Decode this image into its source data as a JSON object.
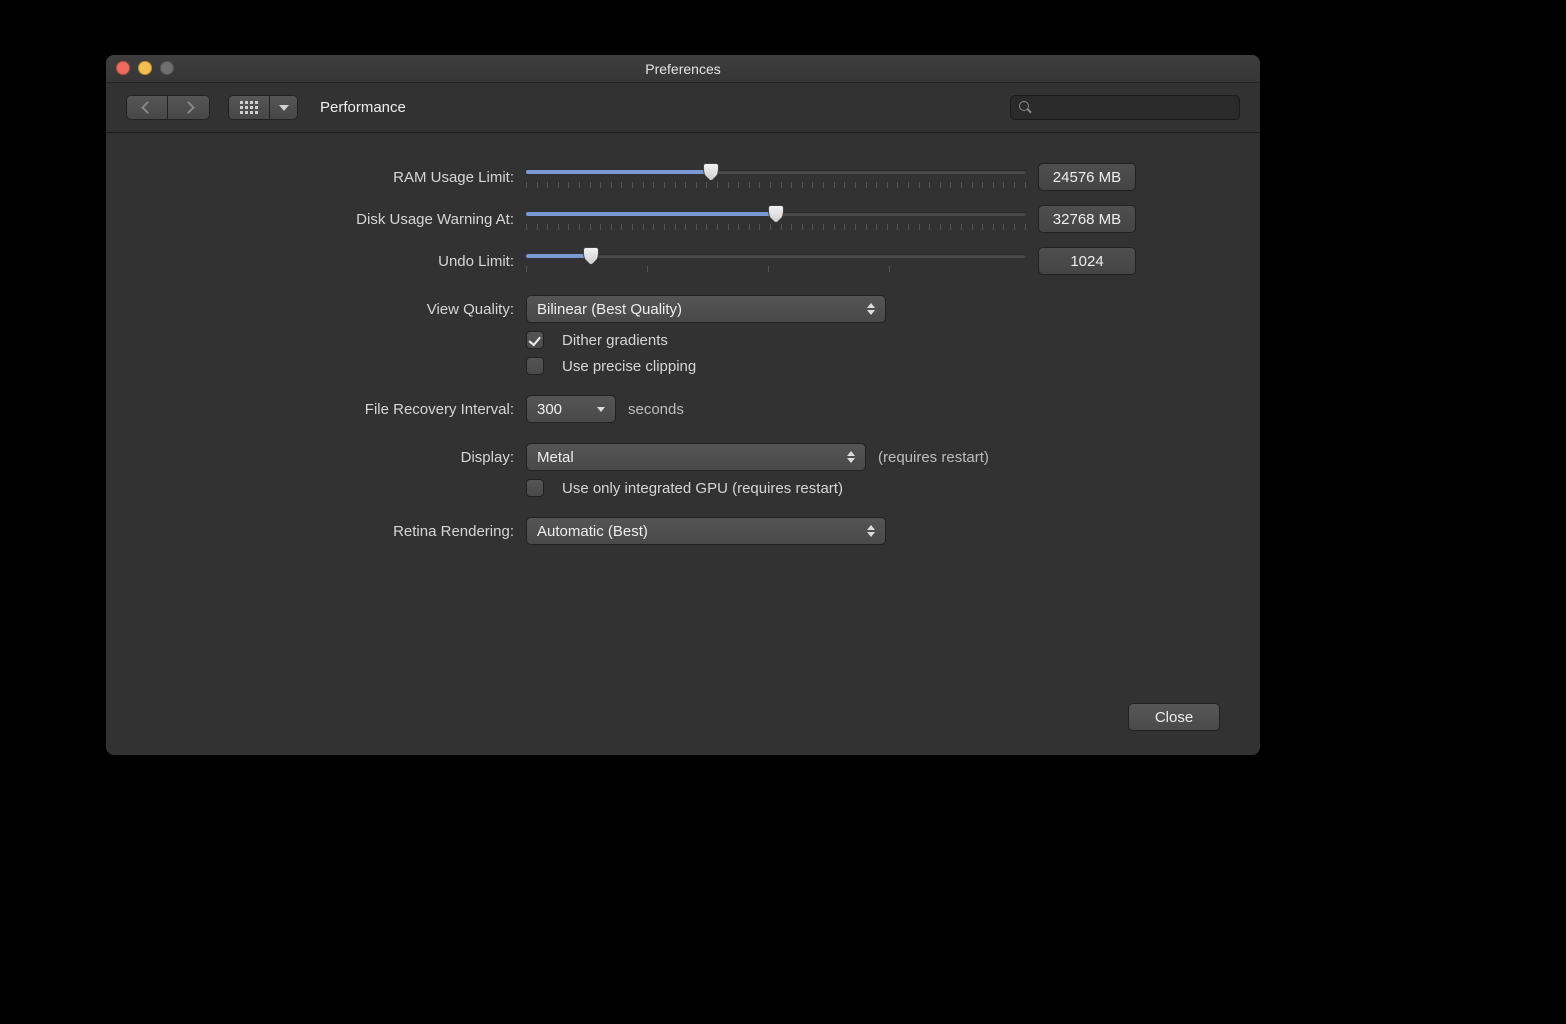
{
  "window": {
    "title": "Preferences"
  },
  "toolbar": {
    "section": "Performance",
    "search_placeholder": ""
  },
  "form": {
    "ram": {
      "label": "RAM Usage Limit:",
      "value": "24576 MB",
      "fill_pct": 37
    },
    "disk": {
      "label": "Disk Usage Warning At:",
      "value": "32768 MB",
      "fill_pct": 50
    },
    "undo": {
      "label": "Undo Limit:",
      "value": "1024",
      "fill_pct": 13
    },
    "view_quality": {
      "label": "View Quality:",
      "selected": "Bilinear (Best Quality)"
    },
    "dither": {
      "label": "Dither gradients",
      "checked": true
    },
    "precise": {
      "label": "Use precise clipping",
      "checked": false
    },
    "recovery": {
      "label": "File Recovery Interval:",
      "selected": "300",
      "unit": "seconds"
    },
    "display": {
      "label": "Display:",
      "selected": "Metal",
      "hint": "(requires restart)"
    },
    "gpu": {
      "label": "Use only integrated GPU (requires restart)",
      "checked": false
    },
    "retina": {
      "label": "Retina Rendering:",
      "selected": "Automatic (Best)"
    }
  },
  "buttons": {
    "close": "Close"
  }
}
